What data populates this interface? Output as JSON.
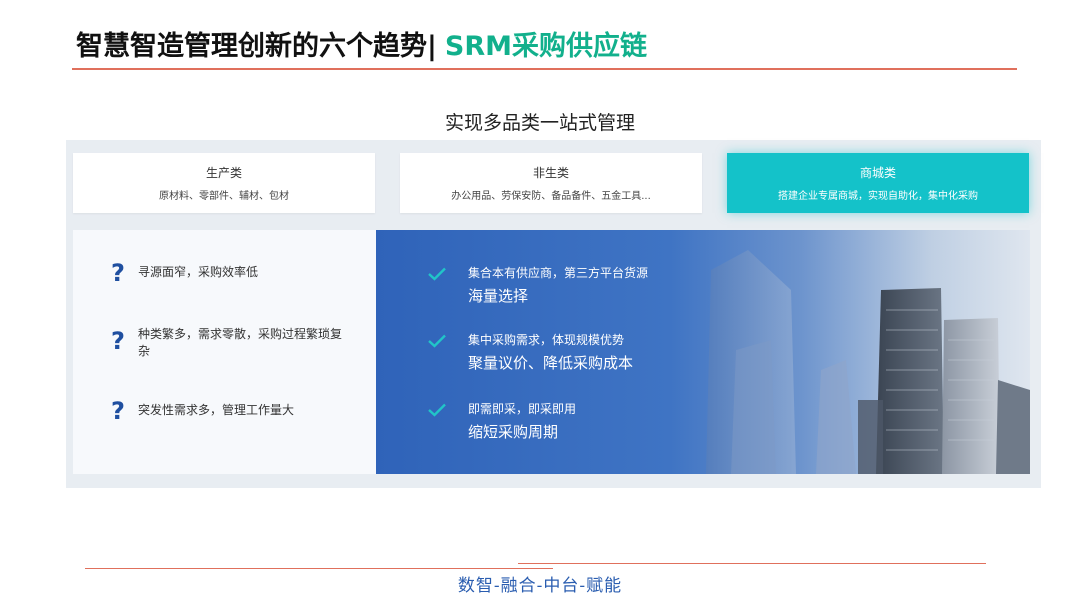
{
  "header": {
    "title": "智慧智造管理创新的六个趋势|",
    "accent": "SRM采购供应链",
    "accent_color": "#12b08c"
  },
  "subtitle": "实现多品类一站式管理",
  "categories": [
    {
      "title": "生产类",
      "desc": "原材料、零部件、辅材、包材",
      "active": false
    },
    {
      "title": "非生类",
      "desc": "办公用品、劳保安防、备品备件、五金工具...",
      "active": false
    },
    {
      "title": "商城类",
      "desc": "搭建企业专属商城，实现自助化，集中化采购",
      "active": true
    }
  ],
  "problems": [
    {
      "icon": "question-icon",
      "symbol": "?",
      "text": "寻源面窄，采购效率低"
    },
    {
      "icon": "question-icon",
      "symbol": "?",
      "text": "种类繁多，需求零散，采购过程繁琐复杂"
    },
    {
      "icon": "question-icon",
      "symbol": "?",
      "text": "突发性需求多，管理工作量大"
    }
  ],
  "solutions": [
    {
      "icon": "check-icon",
      "line1": "集合本有供应商，第三方平台货源",
      "line2": "海量选择"
    },
    {
      "icon": "check-icon",
      "line1": "集中采购需求，体现规模优势",
      "line2": "聚量议价、降低采购成本"
    },
    {
      "icon": "check-icon",
      "line1": "即需即采，即采即用",
      "line2": "缩短采购周期"
    }
  ],
  "footer": {
    "slogan": "数智-融合-中台-赋能"
  },
  "colors": {
    "active_card": "#14c2c9",
    "question_icon": "#1f4fa0",
    "check_icon": "#21c5c8",
    "rule_line": "#e0705c",
    "slogan": "#2a5db0"
  }
}
